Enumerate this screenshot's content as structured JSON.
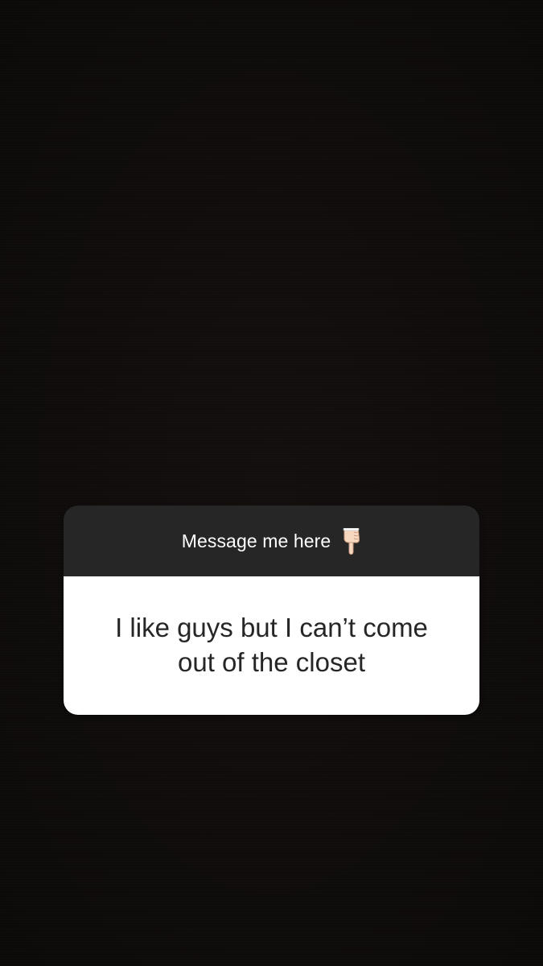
{
  "question_sticker": {
    "header_title": "Message me here",
    "header_icon": "backhand-index-pointing-down-icon",
    "answer_text": "I like guys but I can’t come out of the closet"
  },
  "colors": {
    "background": "#0f0c0b",
    "header_background": "#262626",
    "body_background": "#ffffff",
    "header_text": "#ffffff",
    "answer_text": "#262626"
  }
}
